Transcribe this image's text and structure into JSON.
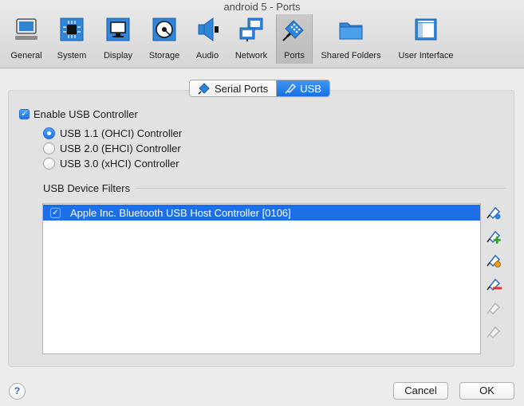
{
  "window": {
    "title": "android 5 - Ports"
  },
  "toolbar": {
    "items": [
      {
        "label": "General",
        "icon": "general-settings-icon"
      },
      {
        "label": "System",
        "icon": "chip-icon"
      },
      {
        "label": "Display",
        "icon": "monitor-icon"
      },
      {
        "label": "Storage",
        "icon": "hard-disk-icon"
      },
      {
        "label": "Audio",
        "icon": "speaker-icon"
      },
      {
        "label": "Network",
        "icon": "network-icon"
      },
      {
        "label": "Ports",
        "icon": "serial-port-plug-icon",
        "active": true
      },
      {
        "label": "Shared Folders",
        "icon": "folder-icon"
      },
      {
        "label": "User Interface",
        "icon": "window-icon"
      }
    ]
  },
  "tabs": {
    "serial": "Serial Ports",
    "usb": "USB",
    "selected": "USB"
  },
  "usb": {
    "enable_label": "Enable USB Controller",
    "enabled": true,
    "options": [
      {
        "label": "USB 1.1 (OHCI) Controller",
        "selected": true
      },
      {
        "label": "USB 2.0 (EHCI) Controller",
        "selected": false
      },
      {
        "label": "USB 3.0 (xHCI) Controller",
        "selected": false
      }
    ],
    "filters_label": "USB Device Filters",
    "filters": [
      {
        "name": "Apple Inc. Bluetooth USB Host Controller [0106]",
        "checked": true,
        "selected": true
      }
    ],
    "side_buttons": [
      {
        "icon": "add-empty-filter-icon",
        "enabled": true
      },
      {
        "icon": "add-filter-from-device-icon",
        "enabled": true
      },
      {
        "icon": "edit-filter-icon",
        "enabled": true
      },
      {
        "icon": "remove-filter-icon",
        "enabled": true
      },
      {
        "icon": "move-filter-up-icon",
        "enabled": false
      },
      {
        "icon": "move-filter-down-icon",
        "enabled": false
      }
    ]
  },
  "footer": {
    "help": "?",
    "cancel": "Cancel",
    "ok": "OK"
  },
  "colors": {
    "accent": "#1e6fe6",
    "toolbar_blue": "#2f86d8"
  }
}
